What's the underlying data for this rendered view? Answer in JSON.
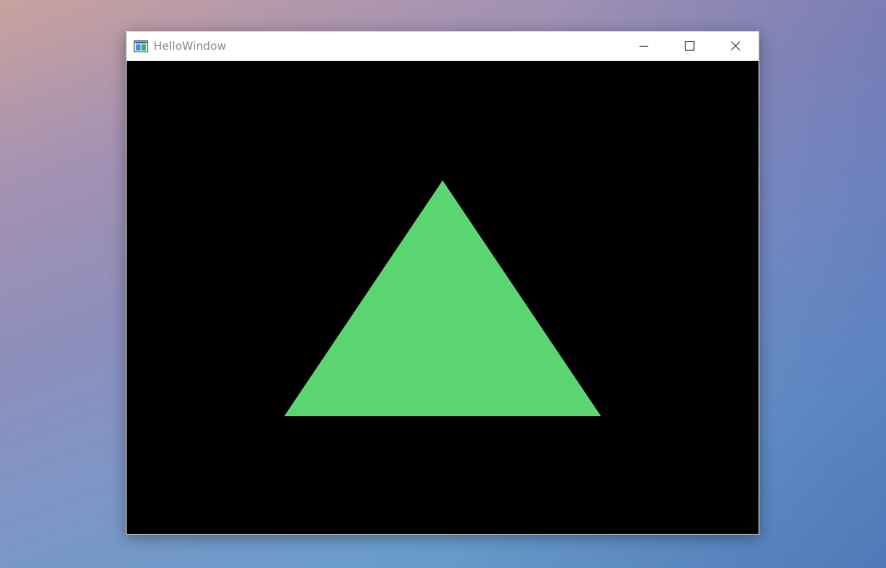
{
  "window": {
    "title": "HelloWindow",
    "app_icon": "application-window-icon",
    "controls": {
      "minimize_icon": "minimize-icon",
      "maximize_icon": "maximize-icon",
      "close_icon": "close-icon"
    }
  },
  "render_area": {
    "background_color": "#000000",
    "shape": "triangle",
    "triangle_color": "#5ad572"
  },
  "colors": {
    "titlebar": "#ffffff",
    "title_text": "#8a8a8a"
  }
}
